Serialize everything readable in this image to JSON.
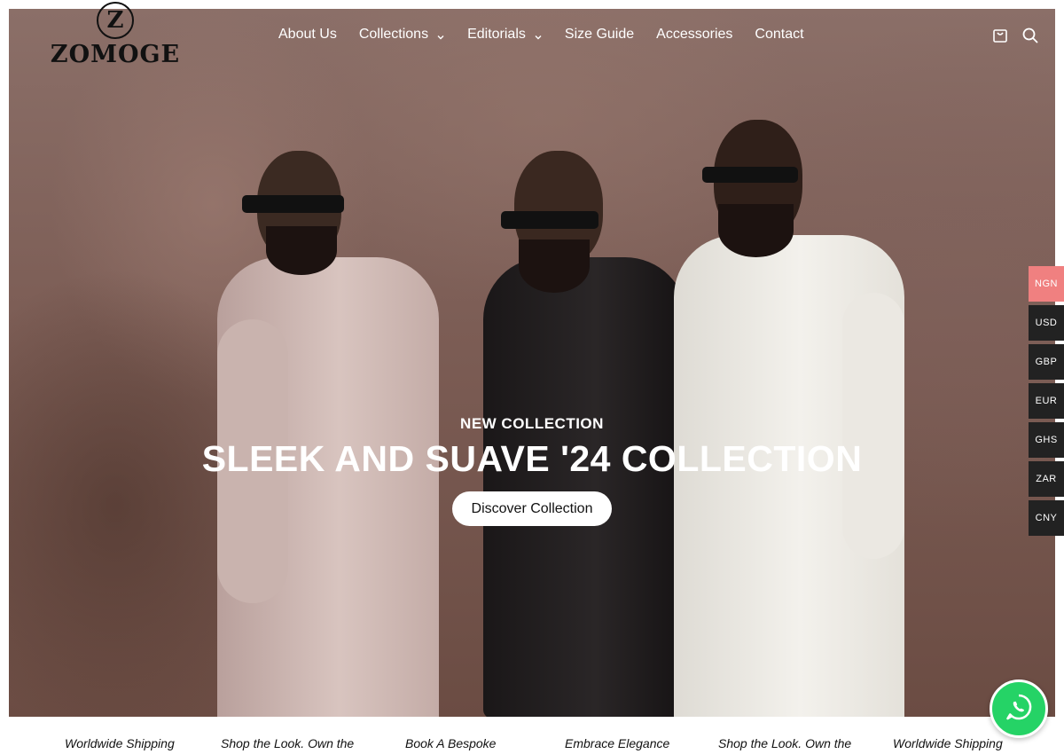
{
  "brand": {
    "name": "ZOMOGE",
    "monogram": "Z"
  },
  "nav": {
    "items": [
      {
        "label": "About Us",
        "dropdown": false
      },
      {
        "label": "Collections",
        "dropdown": true
      },
      {
        "label": "Editorials",
        "dropdown": true
      },
      {
        "label": "Size Guide",
        "dropdown": false
      },
      {
        "label": "Accessories",
        "dropdown": false
      },
      {
        "label": "Contact",
        "dropdown": false
      }
    ]
  },
  "header_icons": [
    {
      "name": "shopping-bag-icon"
    },
    {
      "name": "search-icon"
    }
  ],
  "hero": {
    "eyebrow": "NEW COLLECTION",
    "title": "SLEEK AND SUAVE '24 COLLECTION",
    "cta_label": "Discover Collection"
  },
  "currencies": {
    "selected": "NGN",
    "options": [
      "NGN",
      "USD",
      "GBP",
      "EUR",
      "GHS",
      "ZAR",
      "CNY"
    ]
  },
  "marquee": {
    "items": [
      "Worldwide Shipping",
      "Shop the Look. Own the",
      "Book A Bespoke",
      "Embrace Elegance",
      "Shop the Look. Own the",
      "Worldwide Shipping"
    ]
  },
  "whatsapp": {
    "icon": "whatsapp-icon"
  },
  "colors": {
    "currency_active": "#f08080",
    "currency_inactive": "#222222",
    "whatsapp": "#25d366",
    "hero_backdrop": "#7c5d55"
  }
}
